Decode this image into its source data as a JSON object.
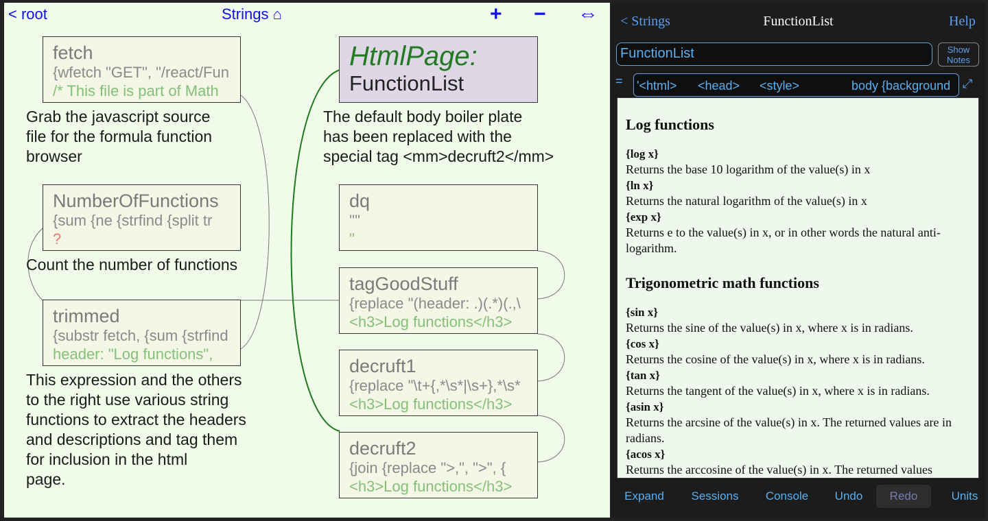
{
  "topnav": {
    "root": "< root",
    "title": "Strings ⌂",
    "zoom_in": "+",
    "zoom_out": "−",
    "fit": "⇔"
  },
  "nodes": {
    "fetch": {
      "name": "fetch",
      "formula": "{wfetch \"GET\", \"/react/Fun",
      "value": "/* This file is part of Math"
    },
    "numfunc": {
      "name": "NumberOfFunctions",
      "formula": "{sum {ne {strfind {split tr",
      "value": "?"
    },
    "trimmed": {
      "name": "trimmed",
      "formula": "{substr fetch, {sum {strfind",
      "value": "header: \"Log functions\","
    },
    "dq": {
      "name": "dq",
      "formula": "'\"'",
      "value": "\""
    },
    "tagGoodStuff": {
      "name": "tagGoodStuff",
      "formula": "{replace \"(header: .)(.*)(.,\\",
      "value": "<h3>Log functions</h3>"
    },
    "decruft1": {
      "name": "decruft1",
      "formula": "{replace \"\\t+{,*\\s*|\\s+},*\\s*",
      "value": "<h3>Log functions</h3>"
    },
    "decruft2": {
      "name": "decruft2",
      "formula": "{join {replace \">,\", \">\", {",
      "value": "<h3>Log functions</h3>"
    }
  },
  "htmlpage": {
    "label": "HtmlPage:",
    "name": "FunctionList"
  },
  "notes": {
    "fetch": [
      "Grab the javascript source",
      "file for the formula function",
      "browser"
    ],
    "numfunc": [
      "Count the number of functions"
    ],
    "trimmed": [
      "This expression and the others",
      "to the right use various string",
      "functions to extract the headers",
      "and descriptions and tag them",
      "for inclusion in the html",
      "page."
    ],
    "htmlpage": [
      "The default body boiler plate",
      "has been replaced with the",
      "special tag <mm>decruft2</mm>"
    ]
  },
  "panel": {
    "back": "< Strings",
    "title": "FunctionList",
    "help": "Help",
    "name_value": "FunctionList",
    "show_notes": [
      "Show",
      "Notes"
    ],
    "eq": "=",
    "tags": [
      "'<html>",
      "<head>",
      "<style>",
      "body {background"
    ],
    "expand_icon": "⤢",
    "preview": {
      "sections": [
        {
          "heading": "Log functions",
          "items": [
            {
              "fn": "{log x}",
              "desc": "Returns the base 10 logarithm of the value(s) in x"
            },
            {
              "fn": "{ln x}",
              "desc": "Returns the natural logarithm of the value(s) in x"
            },
            {
              "fn": "{exp x}",
              "desc": "Returns e to the value(s) in x, or in other words the natural anti-logarithm."
            }
          ]
        },
        {
          "heading": "Trigonometric math functions",
          "items": [
            {
              "fn": "{sin x}",
              "desc": "Returns the sine of the value(s) in x, where x is in radians."
            },
            {
              "fn": "{cos x}",
              "desc": "Returns the cosine of the value(s) in x, where x is in radians."
            },
            {
              "fn": "{tan x}",
              "desc": "Returns the tangent of the value(s) in x, where x is in radians."
            },
            {
              "fn": "{asin x}",
              "desc": "Returns the arcsine of the value(s) in x. The returned values are in radians."
            },
            {
              "fn": "{acos x}",
              "desc": "Returns the arccosine of the value(s) in x. The returned values"
            }
          ]
        }
      ]
    },
    "bottom": [
      "Expand",
      "Sessions",
      "Console",
      "Undo",
      "Redo",
      "Units"
    ]
  }
}
